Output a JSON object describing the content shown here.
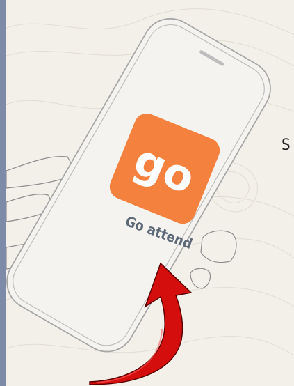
{
  "app": {
    "logo_text": "go",
    "caption": "Go attend",
    "brand_color": "#f5813f",
    "arrow_color": "#d40d0d"
  },
  "side_text": "S",
  "icons": {
    "hand": "hand-illustration",
    "phone": "smartphone-outline",
    "arrow": "curved-arrow-up-icon"
  }
}
